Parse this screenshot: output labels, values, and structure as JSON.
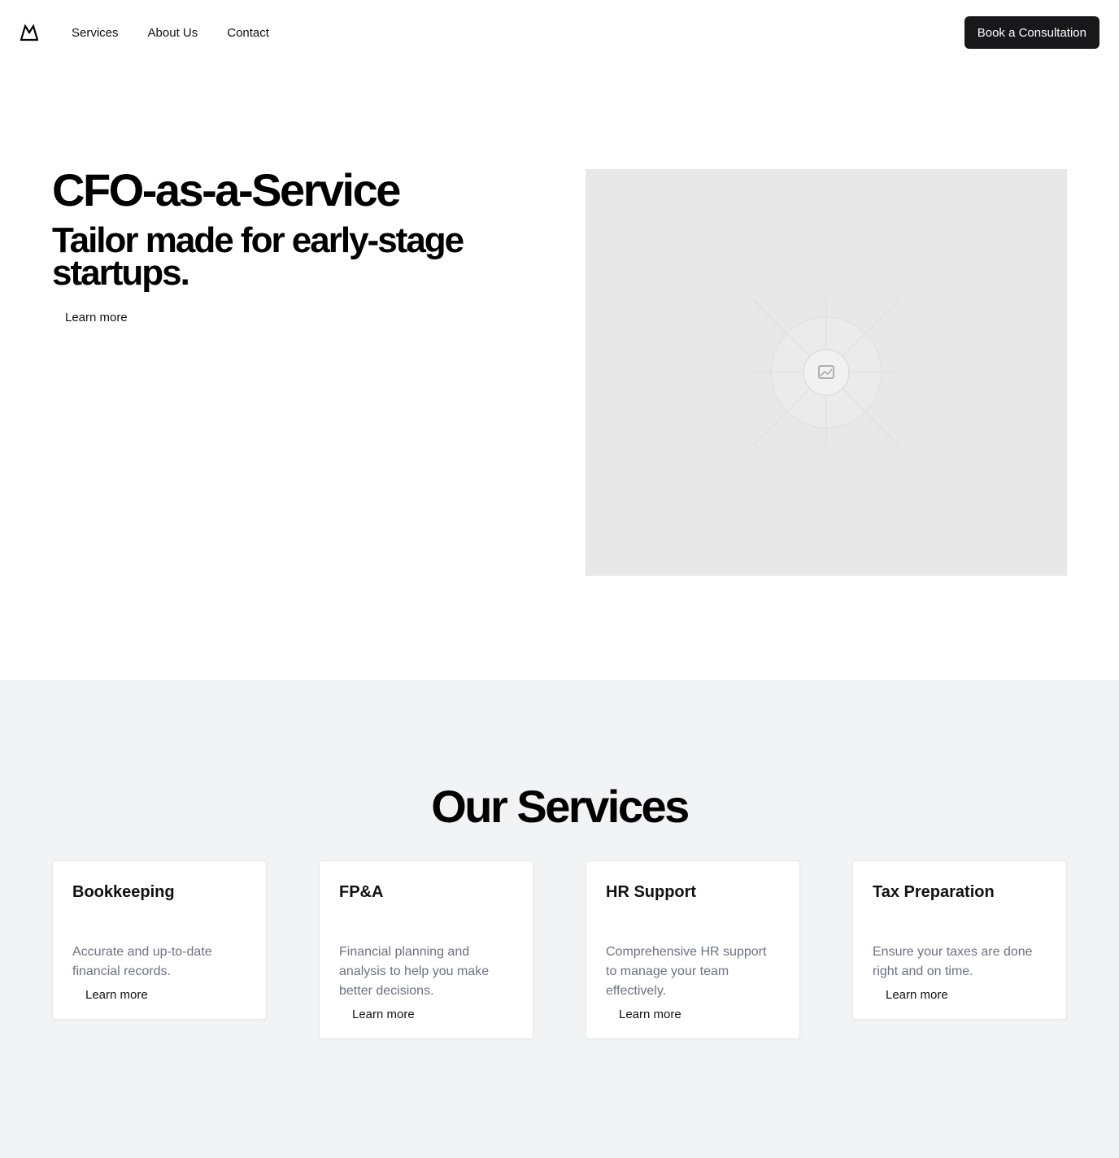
{
  "header": {
    "logo_icon": "mountain-logo-icon",
    "nav": [
      {
        "label": "Services"
      },
      {
        "label": "About Us"
      },
      {
        "label": "Contact"
      }
    ],
    "cta_label": "Book a Consultation"
  },
  "hero": {
    "title": "CFO-as-a-Service",
    "subtitle": "Tailor made for early-stage startups.",
    "link_label": "Learn more",
    "image_icon": "image-placeholder-icon"
  },
  "services": {
    "title": "Our Services",
    "cards": [
      {
        "title": "Bookkeeping",
        "description": "Accurate and up-to-date financial records.",
        "link_label": "Learn more"
      },
      {
        "title": "FP&A",
        "description": "Financial planning and analysis to help you make better decisions.",
        "link_label": "Learn more"
      },
      {
        "title": "HR Support",
        "description": "Comprehensive HR support to manage your team effectively.",
        "link_label": "Learn more"
      },
      {
        "title": "Tax Preparation",
        "description": "Ensure your taxes are done right and on time.",
        "link_label": "Learn more"
      }
    ]
  },
  "colors": {
    "primary_button": "#18181b",
    "page_background": "#ffffff",
    "section_background": "#f2f3f5",
    "placeholder_background": "#e8e8e8",
    "muted_text": "#6b7280"
  }
}
